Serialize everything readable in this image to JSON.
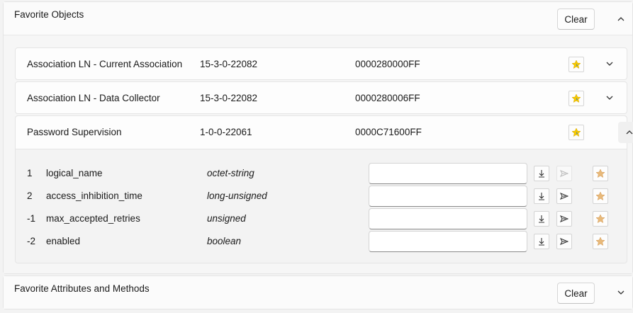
{
  "favorite_objects": {
    "title": "Favorite Objects",
    "clear_label": "Clear",
    "objects": [
      {
        "name": "Association LN - Current Association",
        "class_id": "15-3-0-22082",
        "obis": "0000280000FF"
      },
      {
        "name": "Association LN - Data Collector",
        "class_id": "15-3-0-22082",
        "obis": "0000280006FF"
      }
    ],
    "expanded_object": {
      "name": "Password Supervision",
      "class_id": "1-0-0-22061",
      "obis": "0000C71600FF",
      "attributes": [
        {
          "index": "1",
          "name": "logical_name",
          "type": "octet-string",
          "value": ""
        },
        {
          "index": "2",
          "name": "access_inhibition_time",
          "type": "long-unsigned",
          "value": ""
        },
        {
          "index": "-1",
          "name": "max_accepted_retries",
          "type": "unsigned",
          "value": ""
        },
        {
          "index": "-2",
          "name": "enabled",
          "type": "boolean",
          "value": ""
        }
      ]
    }
  },
  "favorite_attributes": {
    "title": "Favorite Attributes and Methods",
    "clear_label": "Clear"
  },
  "colors": {
    "star_gold": "#f5c800",
    "star_accent": "#2a7bd4",
    "star_outline_fill": "#e8b97a"
  },
  "icons": {
    "favorite_star": "star-filled-icon",
    "attribute_star": "star-icon",
    "read": "download-arrow-icon",
    "write": "send-icon",
    "expand": "chevron-down-icon",
    "collapse": "chevron-up-icon"
  }
}
